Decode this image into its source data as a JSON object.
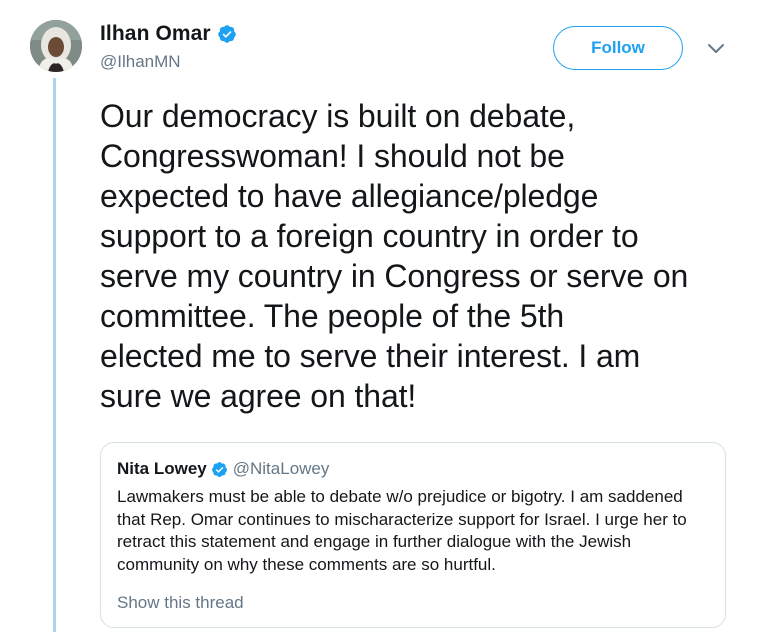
{
  "author": {
    "display_name": "Ilhan Omar",
    "handle": "@IlhanMN",
    "avatar_icon": "user-avatar",
    "verified_icon": "verified-badge-icon"
  },
  "actions": {
    "follow_label": "Follow",
    "menu_icon": "chevron-down-icon"
  },
  "tweet": {
    "text": "Our democracy is built on debate,\nCongresswoman! I should not be\nexpected to have allegiance/pledge\nsupport to a foreign country in order to\nserve my country in Congress or serve on\ncommittee. The people of the 5th\nelected me to serve their interest. I am\nsure we agree on that!"
  },
  "quoted_tweet": {
    "display_name": "Nita Lowey",
    "handle": "@NitaLowey",
    "text": "Lawmakers must be able to debate w/o prejudice or bigotry. I am saddened\nthat Rep. Omar continues to mischaracterize support for Israel. I urge her to\nretract this statement and engage in further dialogue with the Jewish\ncommunity on why these comments are so hurtful.",
    "show_thread_label": "Show this thread"
  },
  "colors": {
    "accent": "#1da1f2",
    "thread_line": "#a9d5f5",
    "secondary_text": "#657786",
    "primary_text": "#14171a",
    "card_border": "#d6e0e7"
  }
}
